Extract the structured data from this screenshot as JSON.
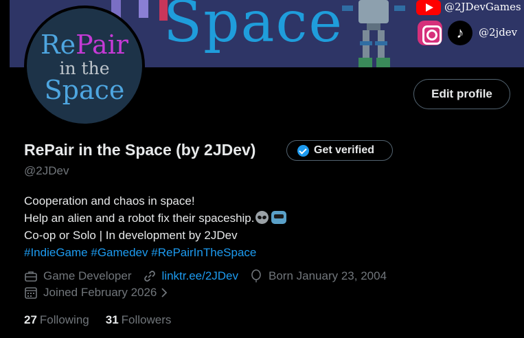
{
  "banner": {
    "title": "Space",
    "youtube_handle": "@2JDevGames",
    "social_handle": "@2jdev"
  },
  "avatar": {
    "line1_a": "Re",
    "line1_b": "Pair",
    "line2": "in the",
    "line3": "Space"
  },
  "actions": {
    "edit_profile_label": "Edit profile"
  },
  "profile": {
    "display_name": "RePair in the Space (by 2JDev)",
    "get_verified_label": "Get verified",
    "handle": "@2JDev",
    "bio": {
      "line1": "Cooperation and chaos in space!",
      "line2": "Help an alien and a robot fix their spaceship.",
      "line3": "Co-op or Solo | In development by 2JDev",
      "hashtags": [
        "#IndieGame",
        "#Gamedev",
        "#RePairInTheSpace"
      ]
    },
    "category": "Game Developer",
    "website": "linktr.ee/2JDev",
    "birth": "Born January 23, 2004",
    "joined": "Joined February 2026",
    "following_count": "27",
    "following_label": "Following",
    "followers_count": "31",
    "followers_label": "Followers"
  },
  "colors": {
    "accent": "#1d9bf0",
    "background": "#000000",
    "muted_text": "#71767b",
    "banner_bg": "#2e3566"
  },
  "icons": [
    "youtube-icon",
    "instagram-icon",
    "tiktok-icon",
    "verified-badge-icon",
    "briefcase-icon",
    "link-icon",
    "balloon-icon",
    "calendar-icon",
    "chevron-right-icon"
  ]
}
